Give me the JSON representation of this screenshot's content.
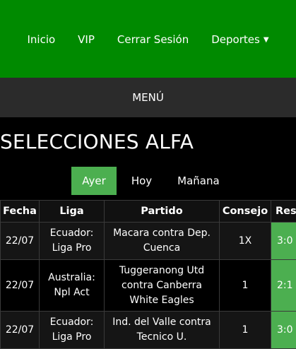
{
  "nav": {
    "items": [
      "Inicio",
      "VIP",
      "Cerrar Sesión",
      "Deportes"
    ],
    "dropdown_caret": "▼"
  },
  "menu": {
    "label": "MENÚ"
  },
  "section": {
    "title": "SELECCIONES ALFA"
  },
  "tabs": [
    {
      "label": "Ayer",
      "active": true
    },
    {
      "label": "Hoy",
      "active": false
    },
    {
      "label": "Mañana",
      "active": false
    }
  ],
  "table": {
    "headers": [
      "Fecha",
      "Liga",
      "Partido",
      "Consejo",
      "Res"
    ],
    "rows": [
      {
        "fecha": "22/07",
        "liga": "Ecuador: Liga Pro",
        "partido": "Macara contra Dep. Cuenca",
        "consejo": "1X",
        "resultado": "3:0"
      },
      {
        "fecha": "22/07",
        "liga": "Australia: Npl Act",
        "partido": "Tuggeranong Utd contra Canberra White Eagles",
        "consejo": "1",
        "resultado": "2:1"
      },
      {
        "fecha": "22/07",
        "liga": "Ecuador: Liga Pro",
        "partido": "Ind. del Valle contra Tecnico U.",
        "consejo": "1",
        "resultado": "3:0"
      }
    ]
  },
  "colors": {
    "nav_bg": "#008a00",
    "menu_bg": "#2b2b2b",
    "accent": "#4caf50",
    "page_bg": "#000000"
  }
}
